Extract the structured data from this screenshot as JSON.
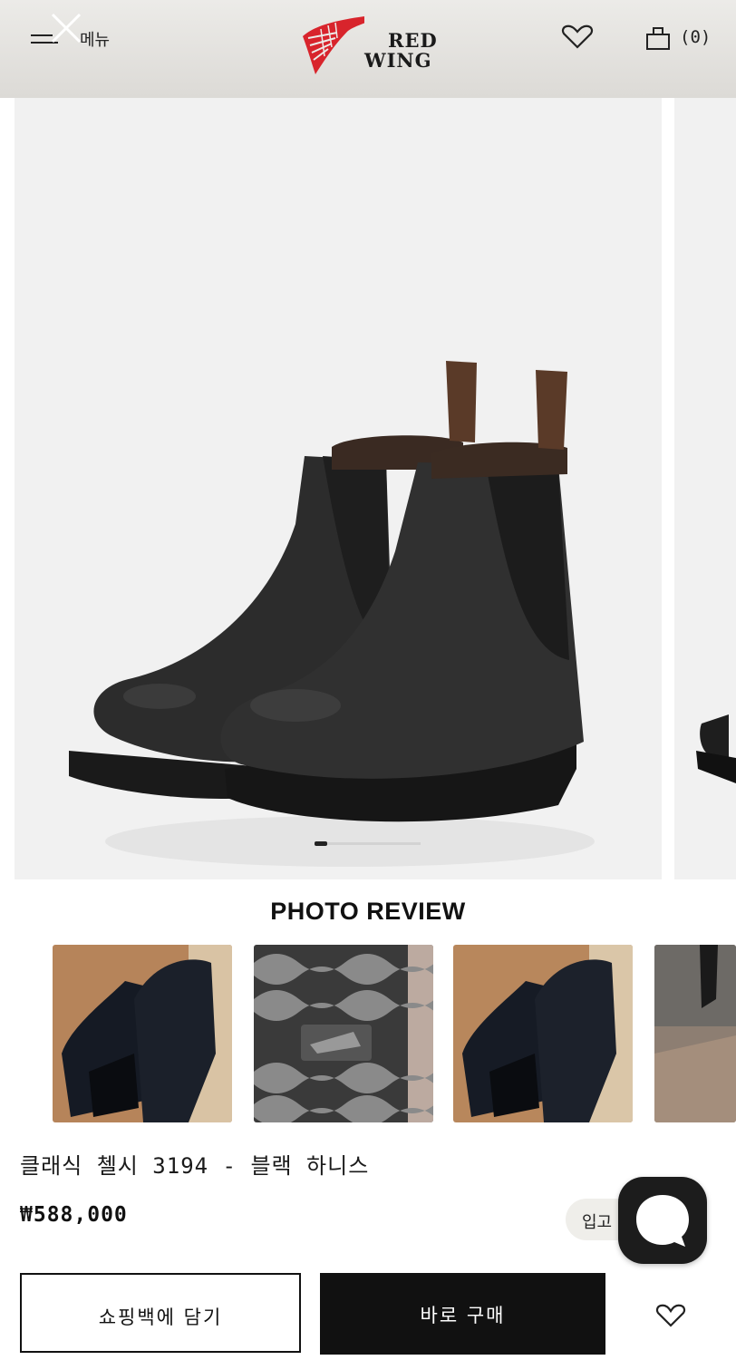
{
  "header": {
    "menu_label": "메뉴",
    "brand_line1": "RED",
    "brand_line2": "WING",
    "cart_count": "(0)",
    "icons": [
      "hamburger-icon",
      "close-icon",
      "red-wing-logo",
      "heart-icon",
      "shopping-bag-icon"
    ]
  },
  "gallery": {
    "current_slide": 1,
    "progress": 0.12
  },
  "photo_review": {
    "title": "PHOTO REVIEW"
  },
  "product": {
    "name": "클래식 첼시 3194 - 블랙 하니스",
    "price": "₩588,000",
    "badge": "입고"
  },
  "actions": {
    "cart_label": "쇼핑백에 담기",
    "buy_label": "바로 구매"
  },
  "colors": {
    "brand_red": "#d8242c",
    "button_black": "#111111",
    "image_bg": "#f1f1f1"
  }
}
